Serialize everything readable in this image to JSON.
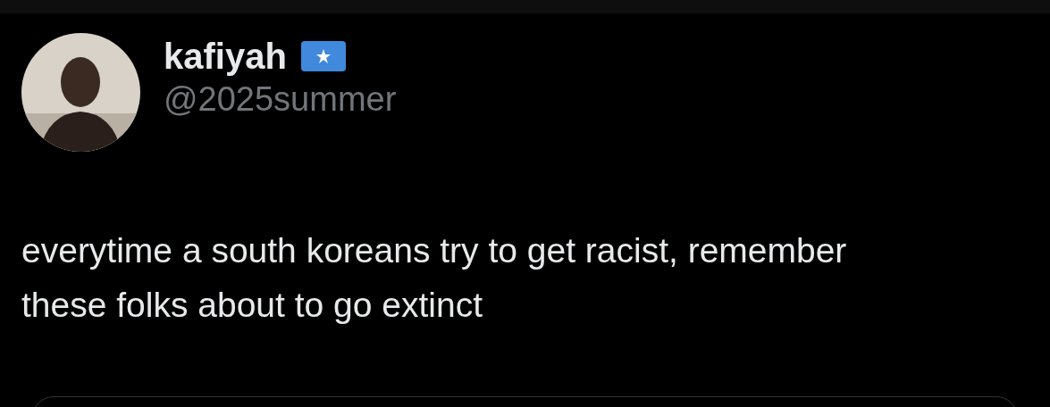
{
  "author": {
    "name": "kafiyah",
    "handle": "@2025summer"
  },
  "tweet": {
    "text": "everytime a south koreans try to get racist, remember these folks about to go extinct"
  }
}
